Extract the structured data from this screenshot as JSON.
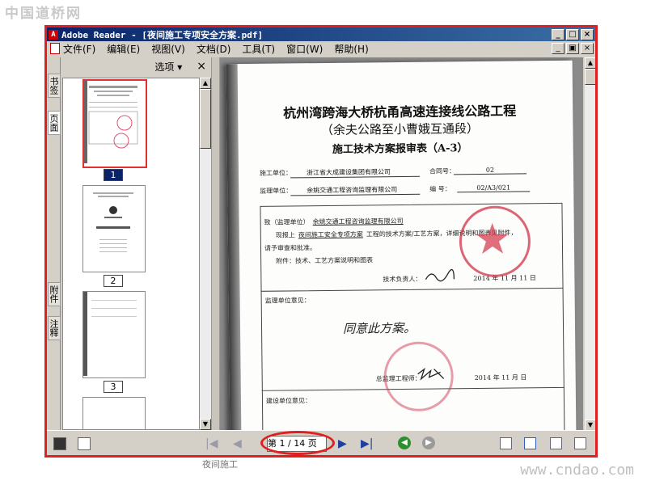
{
  "watermarks": {
    "top": "中国道桥网",
    "bottom": "www.cndao.com"
  },
  "window": {
    "title": "Adobe Reader - [夜间施工专项安全方案.pdf]",
    "app_icon": "pdf-app-icon",
    "controls": [
      "_",
      "□",
      "×"
    ],
    "doc_controls": [
      "_",
      "▣",
      "×"
    ]
  },
  "menu": {
    "items": [
      "文件(F)",
      "编辑(E)",
      "视图(V)",
      "文档(D)",
      "工具(T)",
      "窗口(W)",
      "帮助(H)"
    ]
  },
  "nav_tabs": [
    "书签",
    "页面",
    "附件",
    "注释"
  ],
  "panel": {
    "options_label": "选项 ▾",
    "close": "×",
    "thumbnails": [
      {
        "label": "1",
        "selected": true
      },
      {
        "label": "2",
        "selected": false
      },
      {
        "label": "3",
        "selected": false
      }
    ]
  },
  "document": {
    "title1": "杭州湾跨海大桥杭甬高速连接线公路工程",
    "title2": "（余夫公路至小曹娥互通段）",
    "title3": "施工技术方案报审表（A-3）",
    "contractor_label": "施工单位：",
    "contractor_value": "浙江省大成建设集团有限公司",
    "contract_no_label": "合同号：",
    "contract_no_value": "02",
    "supervisor_label": "监理单位：",
    "supervisor_value": "余姚交通工程咨询监理有限公司",
    "number_label": "编  号：",
    "number_value": "02/A3/021",
    "to_line": "致（监理单位）",
    "to_value": "余姚交通工程咨询监理有限公司",
    "submit_prefix": "现报上",
    "submit_value": "夜间施工安全专项方案",
    "submit_suffix": "工程的技术方案/工艺方案，详细说明和图表见附件，",
    "review_line": "请予审查和批准。",
    "attachment_line": "附件：技术、工艺方案说明和图表",
    "tech_lead_line": "技术负责人：",
    "date1": "2014 年  11 月  11 日",
    "opinion_label": "监理单位意见：",
    "handwriting": "同意此方案。",
    "chief_label": "总监理工程师：",
    "date2": "2014 年  11 月  日",
    "owner_label": "建设单位意见："
  },
  "status": {
    "page_text": "第 1 / 14 页",
    "bottom_note": "夜间施工"
  },
  "colors": {
    "highlight": "#e02020",
    "titlebar": "#0a246a",
    "seal": "#d23246"
  }
}
